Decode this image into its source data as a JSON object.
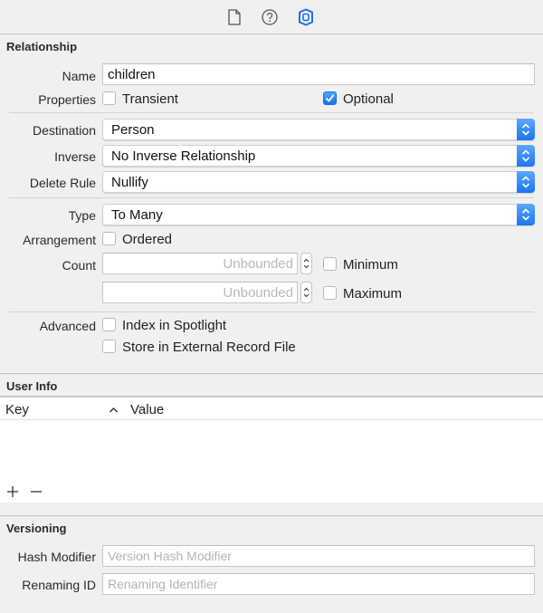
{
  "toolbar": {
    "icons": [
      {
        "name": "file-inspector-icon",
        "active": false
      },
      {
        "name": "quick-help-icon",
        "active": false
      },
      {
        "name": "data-model-inspector-icon",
        "active": true
      }
    ]
  },
  "relationship": {
    "title": "Relationship",
    "name_label": "Name",
    "name_value": "children",
    "properties_label": "Properties",
    "transient_label": "Transient",
    "transient_checked": false,
    "optional_label": "Optional",
    "optional_checked": true,
    "destination_label": "Destination",
    "destination_value": "Person",
    "inverse_label": "Inverse",
    "inverse_value": "No Inverse Relationship",
    "delete_rule_label": "Delete Rule",
    "delete_rule_value": "Nullify",
    "type_label": "Type",
    "type_value": "To Many",
    "arrangement_label": "Arrangement",
    "ordered_label": "Ordered",
    "ordered_checked": false,
    "count_label": "Count",
    "count_min_placeholder": "Unbounded",
    "count_max_placeholder": "Unbounded",
    "minimum_label": "Minimum",
    "minimum_checked": false,
    "maximum_label": "Maximum",
    "maximum_checked": false,
    "advanced_label": "Advanced",
    "index_spotlight_label": "Index in Spotlight",
    "index_spotlight_checked": false,
    "external_record_label": "Store in External Record File",
    "external_record_checked": false
  },
  "user_info": {
    "title": "User Info",
    "columns": [
      "Key",
      "Value"
    ],
    "sort_indicator": "^",
    "rows": [],
    "add_label": "+",
    "remove_label": "−"
  },
  "versioning": {
    "title": "Versioning",
    "hash_modifier_label": "Hash Modifier",
    "hash_modifier_placeholder": "Version Hash Modifier",
    "renaming_id_label": "Renaming ID",
    "renaming_id_placeholder": "Renaming Identifier"
  },
  "colors": {
    "accent": "#1a72ee",
    "panel_bg": "#f0f0f0"
  }
}
